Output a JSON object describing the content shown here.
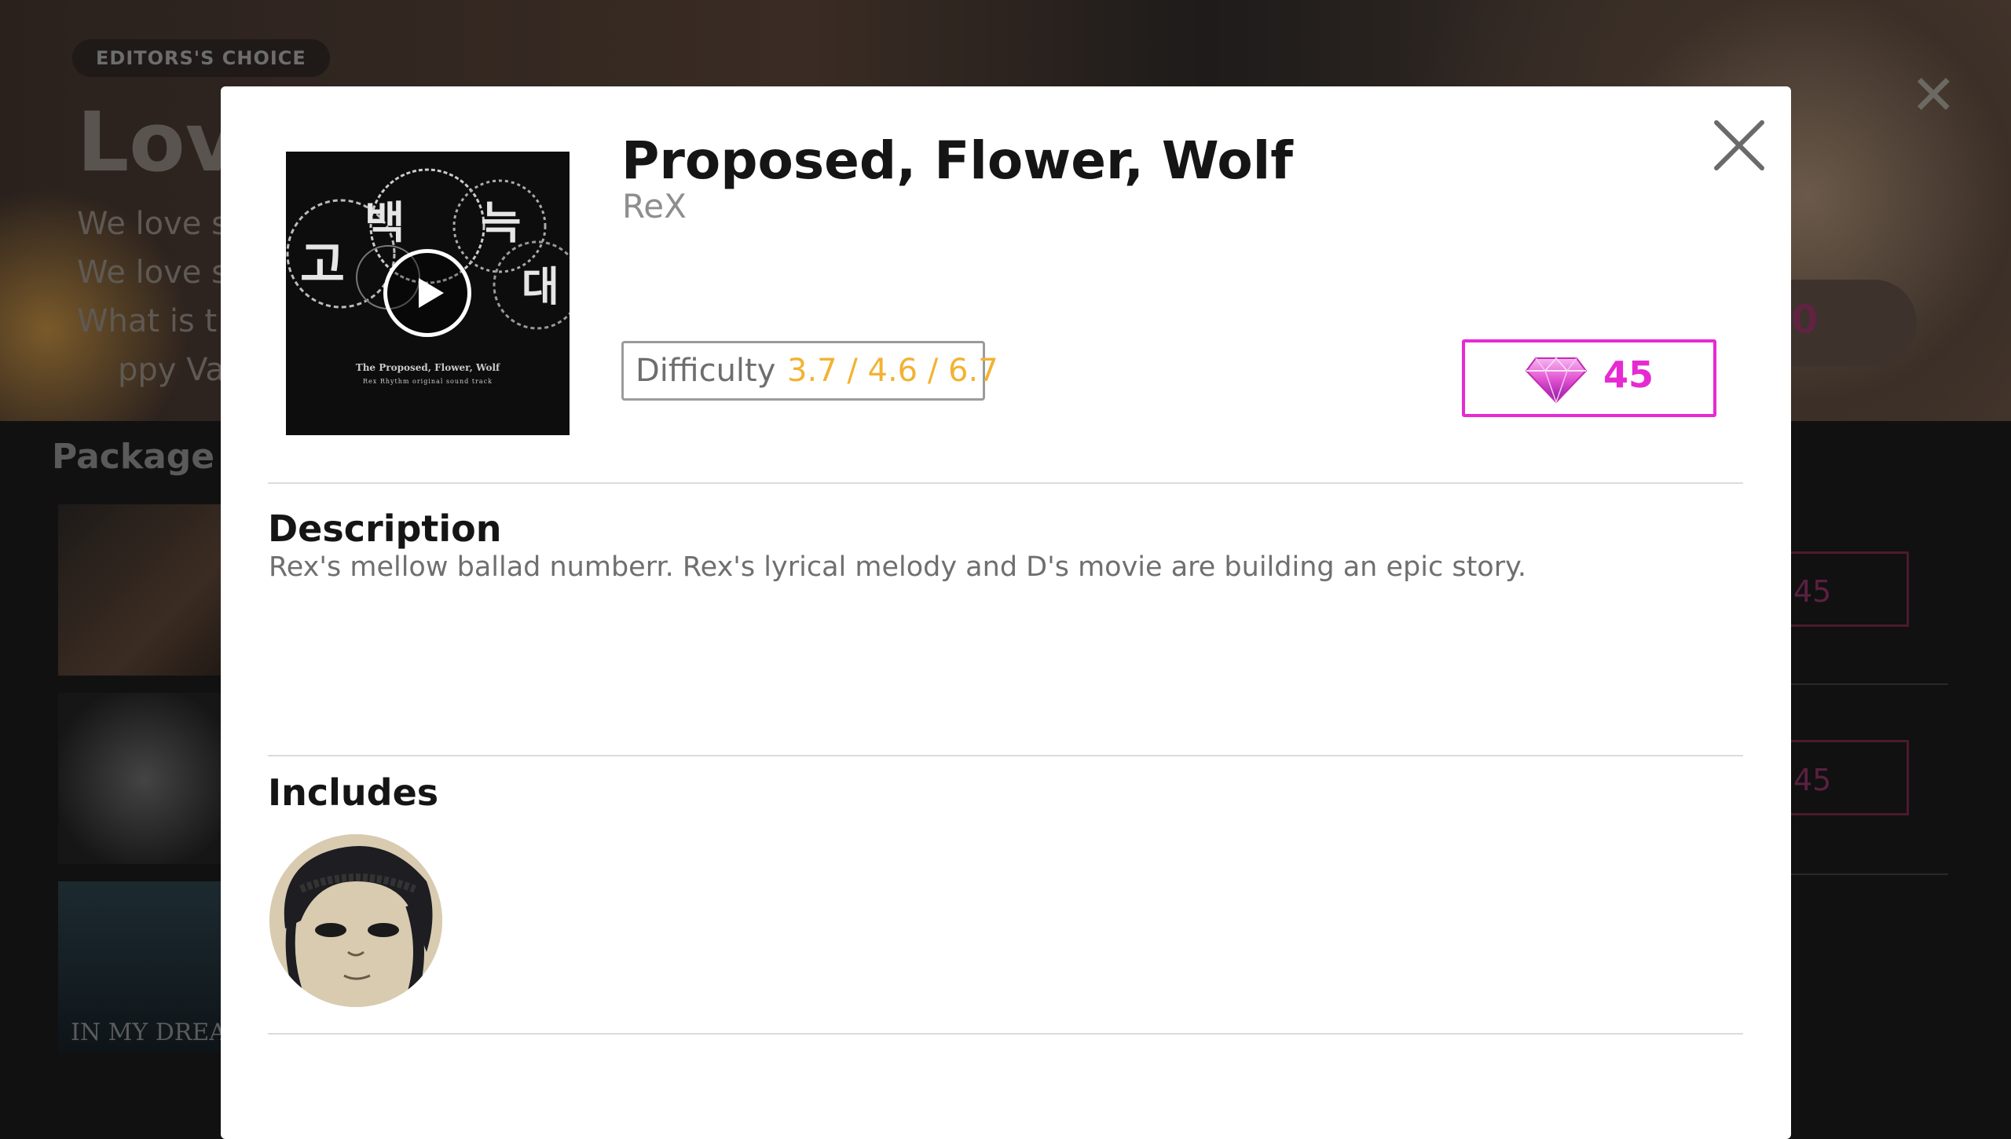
{
  "background": {
    "badge": "EDITORS'S CHOICE",
    "hero_title": "Love",
    "hero_lines": [
      "We love s",
      "We love s",
      "What is t",
      "ppy Va"
    ],
    "hero_price_fragment": "0",
    "section_title": "Package li",
    "thumb_label_3": "IN MY DREAM",
    "ghost_price": "45"
  },
  "modal": {
    "title": "Proposed, Flower, Wolf",
    "artist": "ReX",
    "album_art": {
      "caption_title": "The Proposed, Flower, Wolf",
      "caption_line": "Rex Rhythm original sound track"
    },
    "difficulty": {
      "label": "Difficulty",
      "value": "3.7 / 4.6 / 6.7"
    },
    "price": {
      "amount": "45",
      "currency_icon": "gem-icon",
      "accent_color": "#e62ad2"
    },
    "description": {
      "heading": "Description",
      "text": "Rex's mellow ballad numberr. Rex's lyrical melody and D's movie are building an epic story."
    },
    "includes": {
      "heading": "Includes",
      "items": [
        {
          "type": "character-avatar"
        }
      ]
    },
    "close_icon": "close-icon",
    "play_icon": "play-icon"
  },
  "colors": {
    "accent": "#e62ad2",
    "difficulty_value": "#f2b232"
  }
}
